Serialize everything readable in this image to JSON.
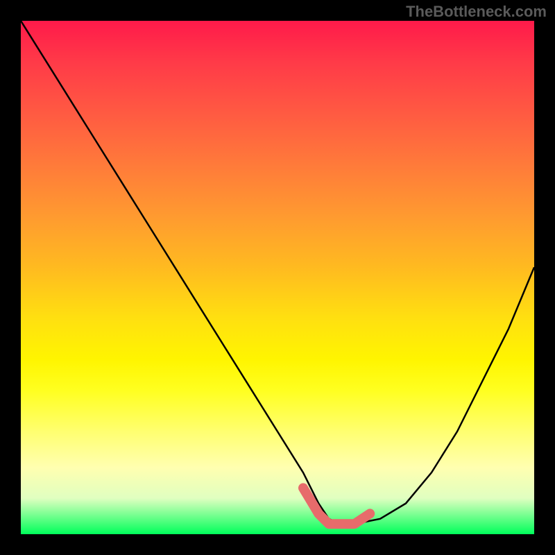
{
  "watermark": "TheBottleneck.com",
  "chart_data": {
    "type": "line",
    "title": "",
    "xlabel": "",
    "ylabel": "",
    "xlim": [
      0,
      100
    ],
    "ylim": [
      0,
      100
    ],
    "grid": false,
    "curve": {
      "name": "bottleneck-curve",
      "color": "#000000",
      "x": [
        0,
        5,
        10,
        15,
        20,
        25,
        30,
        35,
        40,
        45,
        50,
        55,
        58,
        60,
        62,
        65,
        70,
        75,
        80,
        85,
        90,
        95,
        100
      ],
      "y": [
        100,
        92,
        84,
        76,
        68,
        60,
        52,
        44,
        36,
        28,
        20,
        12,
        6,
        3,
        2,
        2,
        3,
        6,
        12,
        20,
        30,
        40,
        52
      ]
    },
    "highlight_segment": {
      "name": "optimal-range-marker",
      "color": "#e76b6b",
      "x": [
        55,
        58,
        60,
        62,
        65,
        68
      ],
      "y": [
        9,
        4,
        2,
        2,
        2,
        4
      ]
    },
    "background_gradient_stops": [
      {
        "pos": 0.0,
        "color": "#ff1a4a"
      },
      {
        "pos": 0.5,
        "color": "#ffd010"
      },
      {
        "pos": 0.75,
        "color": "#ffff40"
      },
      {
        "pos": 1.0,
        "color": "#00ff5a"
      }
    ]
  }
}
